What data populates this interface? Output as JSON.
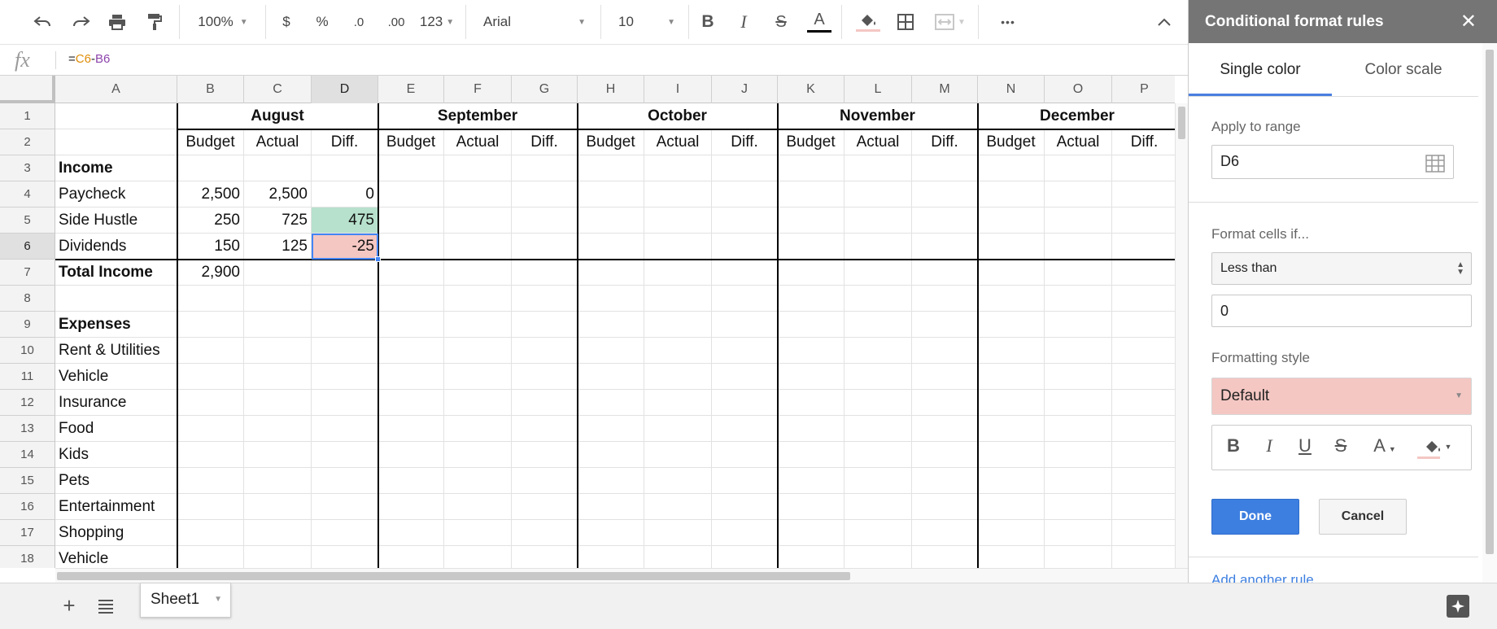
{
  "toolbar": {
    "zoom": "100%",
    "currency": "$",
    "percent": "%",
    "dec_less": ".0",
    "dec_more": ".00",
    "number_format": "123",
    "font": "Arial",
    "font_size": "10",
    "more": "•••"
  },
  "formula_bar": {
    "fx": "fx",
    "eq": "=",
    "ref1": "C6",
    "op": "-",
    "ref2": "B6"
  },
  "columns": [
    "A",
    "B",
    "C",
    "D",
    "E",
    "F",
    "G",
    "H",
    "I",
    "J",
    "K",
    "L",
    "M",
    "N",
    "O",
    "P"
  ],
  "rows": [
    "1",
    "2",
    "3",
    "4",
    "5",
    "6",
    "7",
    "8",
    "9",
    "10",
    "11",
    "12",
    "13",
    "14",
    "15",
    "16",
    "17",
    "18"
  ],
  "months": [
    "August",
    "September",
    "October",
    "November",
    "December"
  ],
  "subheaders": [
    "Budget",
    "Actual",
    "Diff."
  ],
  "sheet": {
    "income_label": "Income",
    "rows": [
      {
        "label": "Paycheck",
        "budget": "2,500",
        "actual": "2,500",
        "diff": "0"
      },
      {
        "label": "Side Hustle",
        "budget": "250",
        "actual": "725",
        "diff": "475"
      },
      {
        "label": "Dividends",
        "budget": "150",
        "actual": "125",
        "diff": "-25"
      }
    ],
    "total_label": "Total Income",
    "total_budget": "2,900",
    "expenses_label": "Expenses",
    "expenses": [
      "Rent & Utilities",
      "Vehicle",
      "Insurance",
      "Food",
      "Kids",
      "Pets",
      "Entertainment",
      "Shopping",
      "Vehicle"
    ]
  },
  "sheet_tab": "Sheet1",
  "panel": {
    "title": "Conditional format rules",
    "close": "✕",
    "tab_single": "Single color",
    "tab_scale": "Color scale",
    "apply_label": "Apply to range",
    "range": "D6",
    "format_if_label": "Format cells if...",
    "condition": "Less than",
    "value": "0",
    "style_label": "Formatting style",
    "style_value": "Default",
    "done": "Done",
    "cancel": "Cancel",
    "add_rule": "Add another rule"
  },
  "colors": {
    "positive_fill": "#b7e1cd",
    "negative_fill": "#f4c7c3",
    "selection": "#4285f4",
    "done_button": "#3d7fe0"
  }
}
